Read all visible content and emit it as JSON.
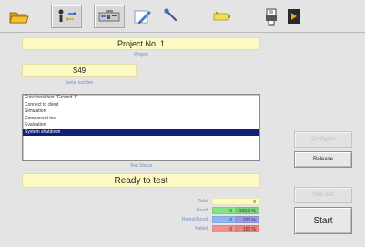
{
  "toolbar": {
    "buttons": [
      {
        "icon": "folder-icon"
      },
      {
        "icon": "person-arrows-icon",
        "pressed": true
      },
      {
        "icon": "instrument-icon",
        "pressed": true
      },
      {
        "icon": "pen-edit-icon"
      },
      {
        "icon": "wrench-icon"
      },
      {
        "icon": "battery-icon"
      },
      {
        "icon": "printer-export-icon"
      },
      {
        "icon": "next-arrow-icon"
      }
    ]
  },
  "project": {
    "value": "Project No. 1",
    "caption": "Project"
  },
  "serial": {
    "value": "S49",
    "caption": "Serial number"
  },
  "test_list": {
    "items": [
      {
        "label": "Functional test \"Ground 1\"",
        "selected": false
      },
      {
        "label": "Connect to client",
        "selected": false
      },
      {
        "label": "Simulation",
        "selected": false
      },
      {
        "label": "Component test",
        "selected": false
      },
      {
        "label": "Evaluation",
        "selected": false
      },
      {
        "label": "System shutdown",
        "selected": true
      }
    ],
    "caption": "Test Status"
  },
  "status": {
    "value": "Ready to test"
  },
  "stats": [
    {
      "label": "Total",
      "v1": "",
      "v2": "0",
      "color": "#fdfac4",
      "split": false
    },
    {
      "label": "Good",
      "v1": "0",
      "v2": "100.0 %",
      "color": "#86e486",
      "c2": "#7ed37e",
      "split": true
    },
    {
      "label": "Retest/Good",
      "v1": "0",
      "v2": "100 %",
      "color": "#8fb8f0",
      "c2": "#9a9ae6",
      "split": true
    },
    {
      "label": "Failed",
      "v1": "0",
      "v2": "100 %",
      "color": "#f09090",
      "c2": "#ee8080",
      "split": true
    }
  ],
  "buttons": {
    "btn1": "Configure",
    "btn2": "Release",
    "btn3": "Stop test",
    "start": "Start"
  }
}
